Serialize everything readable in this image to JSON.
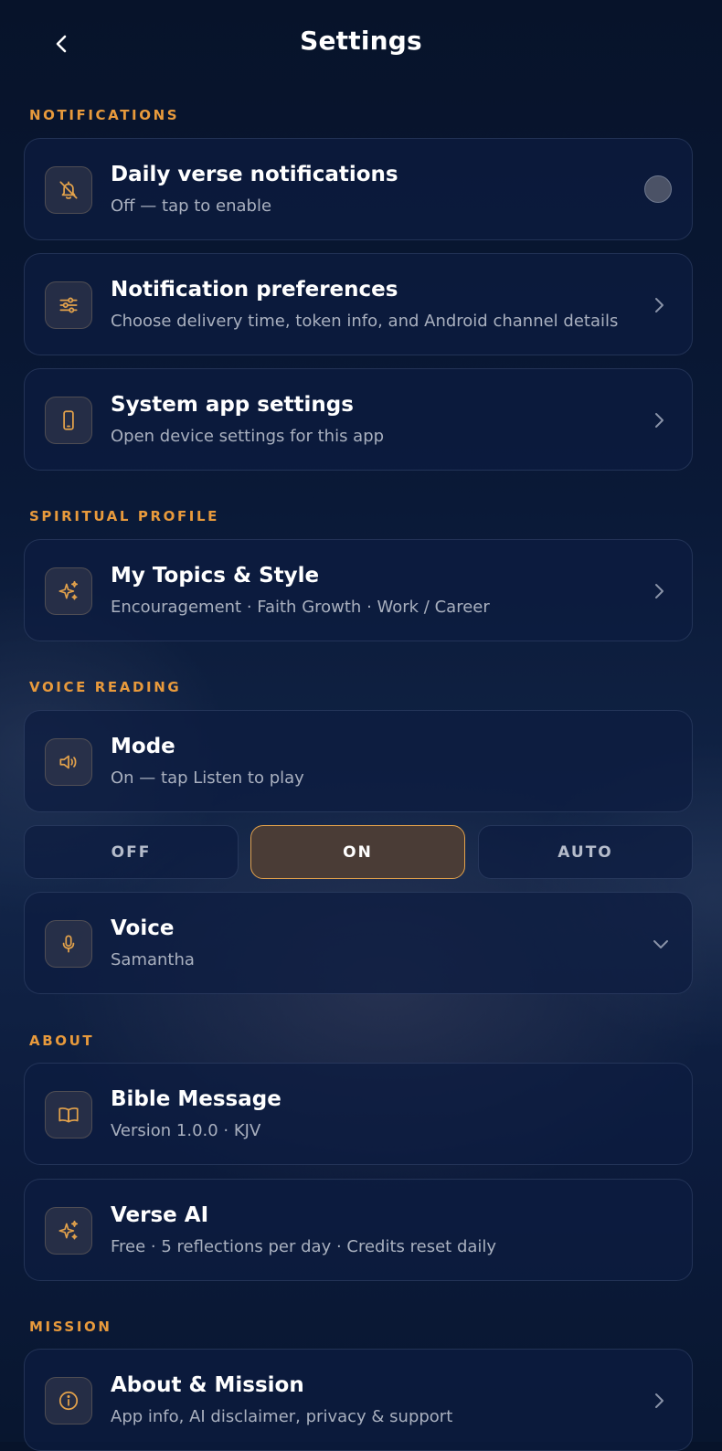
{
  "header": {
    "title": "Settings"
  },
  "sections": {
    "notifications": "NOTIFICATIONS",
    "spiritual_profile": "SPIRITUAL PROFILE",
    "voice_reading": "VOICE READING",
    "about": "ABOUT",
    "mission": "MISSION"
  },
  "notifications": {
    "daily": {
      "title": "Daily verse notifications",
      "subtitle": "Off — tap to enable",
      "icon": "bell-off-icon",
      "enabled": false
    },
    "preferences": {
      "title": "Notification preferences",
      "subtitle": "Choose delivery time, token info, and Android channel details",
      "icon": "sliders-icon"
    },
    "system": {
      "title": "System app settings",
      "subtitle": "Open device settings for this app",
      "icon": "phone-icon"
    }
  },
  "spiritual": {
    "topics": {
      "title": "My Topics & Style",
      "subtitle": "Encouragement · Faith Growth · Work / Career",
      "icon": "sparkles-icon"
    }
  },
  "voice": {
    "mode": {
      "title": "Mode",
      "subtitle": "On — tap Listen to play",
      "icon": "speaker-icon"
    },
    "segments": {
      "off": "OFF",
      "on": "ON",
      "auto": "AUTO",
      "selected": "ON"
    },
    "voice": {
      "title": "Voice",
      "subtitle": "Samantha",
      "icon": "microphone-icon"
    }
  },
  "about": {
    "app": {
      "title": "Bible Message",
      "subtitle": "Version 1.0.0 · KJV",
      "icon": "book-icon"
    },
    "ai": {
      "title": "Verse AI",
      "subtitle": "Free · 5 reflections per day · Credits reset daily",
      "icon": "sparkles-icon"
    }
  },
  "mission": {
    "about": {
      "title": "About & Mission",
      "subtitle": "App info, AI disclaimer, privacy & support",
      "icon": "info-icon"
    }
  },
  "colors": {
    "accent": "#e89a3c",
    "icon": "#e3a24b",
    "background": "#0a1937",
    "card": "#0c1c40"
  }
}
